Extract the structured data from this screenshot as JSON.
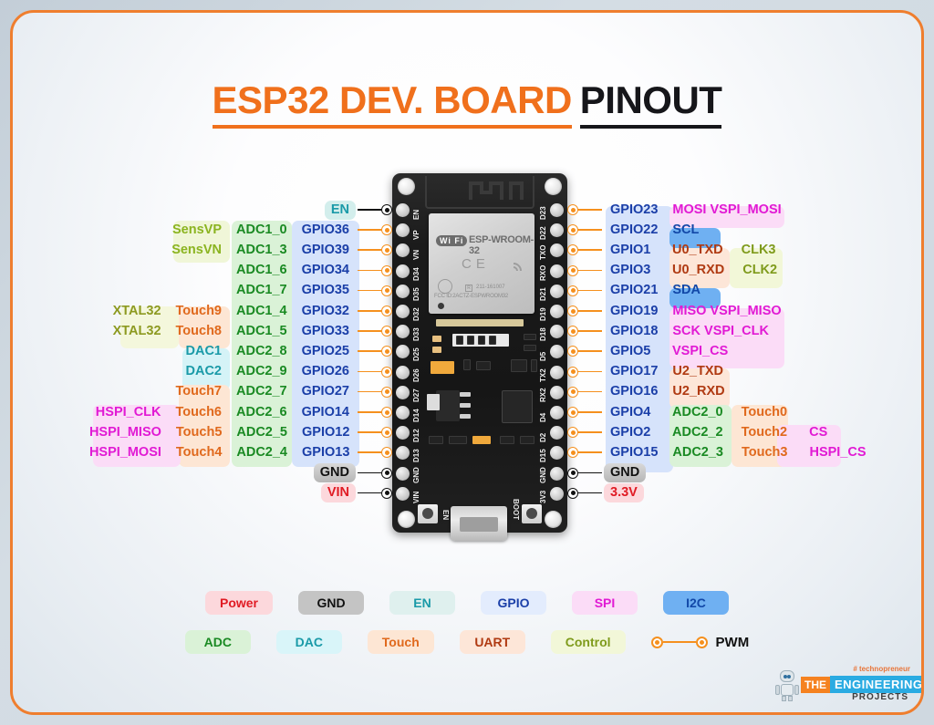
{
  "title": {
    "part1": "ESP32 DEV. BOARD",
    "part2": "PINOUT"
  },
  "board": {
    "module_name": "ESP-WROOM-32",
    "wifi_logo": "Wi Fi",
    "fcc": "FCC ID:2ACTZ-ESPWROOM32",
    "module_id": "211-161007",
    "ce_mark": "CE",
    "r_mark": "R",
    "btn_en": "EN",
    "btn_boot": "BOOT",
    "silk_left": [
      "EN",
      "VP",
      "VN",
      "D34",
      "D35",
      "D32",
      "D33",
      "D25",
      "D26",
      "D27",
      "D14",
      "D12",
      "D13",
      "GND",
      "VIN"
    ],
    "silk_right": [
      "D23",
      "D22",
      "TXO",
      "RXO",
      "D21",
      "D19",
      "D18",
      "D5",
      "TX2",
      "RX2",
      "D4",
      "D2",
      "D15",
      "GND",
      "3V3"
    ]
  },
  "left_pins": [
    {
      "gpio": "EN",
      "conn": "plain",
      "adc": "",
      "touch": "",
      "extra": "",
      "extra2": ""
    },
    {
      "gpio": "GPIO36",
      "conn": "pwm",
      "adc": "ADC1_0",
      "touch": "",
      "extra": "SensVP",
      "extra2": ""
    },
    {
      "gpio": "GPIO39",
      "conn": "pwm",
      "adc": "ADC1_3",
      "touch": "",
      "extra": "SensVN",
      "extra2": ""
    },
    {
      "gpio": "GPIO34",
      "conn": "pwm",
      "adc": "ADC1_6",
      "touch": "",
      "extra": "",
      "extra2": ""
    },
    {
      "gpio": "GPIO35",
      "conn": "pwm",
      "adc": "ADC1_7",
      "touch": "",
      "extra": "",
      "extra2": ""
    },
    {
      "gpio": "GPIO32",
      "conn": "pwm",
      "adc": "ADC1_4",
      "touch": "Touch9",
      "extra": "XTAL32",
      "extra2": ""
    },
    {
      "gpio": "GPIO33",
      "conn": "pwm",
      "adc": "ADC1_5",
      "touch": "Touch8",
      "extra": "XTAL32",
      "extra2": ""
    },
    {
      "gpio": "GPIO25",
      "conn": "pwm",
      "adc": "ADC2_8",
      "touch": "DAC1",
      "extra": "",
      "extra2": ""
    },
    {
      "gpio": "GPIO26",
      "conn": "pwm",
      "adc": "ADC2_9",
      "touch": "DAC2",
      "extra": "",
      "extra2": ""
    },
    {
      "gpio": "GPIO27",
      "conn": "pwm",
      "adc": "ADC2_7",
      "touch": "Touch7",
      "extra": "",
      "extra2": ""
    },
    {
      "gpio": "GPIO14",
      "conn": "pwm",
      "adc": "ADC2_6",
      "touch": "Touch6",
      "extra": "HSPI_CLK",
      "extra2": ""
    },
    {
      "gpio": "GPIO12",
      "conn": "pwm",
      "adc": "ADC2_5",
      "touch": "Touch5",
      "extra": "HSPI_MISO",
      "extra2": ""
    },
    {
      "gpio": "GPIO13",
      "conn": "pwm",
      "adc": "ADC2_4",
      "touch": "Touch4",
      "extra": "HSPI_MOSI",
      "extra2": ""
    },
    {
      "gpio": "GND",
      "conn": "plain",
      "adc": "",
      "touch": "",
      "extra": "",
      "extra2": ""
    },
    {
      "gpio": "VIN",
      "conn": "plain",
      "adc": "",
      "touch": "",
      "extra": "",
      "extra2": ""
    }
  ],
  "right_pins": [
    {
      "gpio": "GPIO23",
      "conn": "pwm",
      "f1": "MOSI VSPI_MOSI",
      "f2": "",
      "f3": ""
    },
    {
      "gpio": "GPIO22",
      "conn": "pwm",
      "f1": "SCL",
      "f2": "",
      "f3": ""
    },
    {
      "gpio": "GPIO1",
      "conn": "pwm",
      "f1": "U0_TXD",
      "f2": "CLK3",
      "f3": ""
    },
    {
      "gpio": "GPIO3",
      "conn": "pwm",
      "f1": "U0_RXD",
      "f2": "CLK2",
      "f3": ""
    },
    {
      "gpio": "GPIO21",
      "conn": "pwm",
      "f1": "SDA",
      "f2": "",
      "f3": ""
    },
    {
      "gpio": "GPIO19",
      "conn": "pwm",
      "f1": "MISO VSPI_MISO",
      "f2": "",
      "f3": ""
    },
    {
      "gpio": "GPIO18",
      "conn": "pwm",
      "f1": "SCK VSPI_CLK",
      "f2": "",
      "f3": ""
    },
    {
      "gpio": "GPIO5",
      "conn": "pwm",
      "f1": "VSPI_CS",
      "f2": "",
      "f3": ""
    },
    {
      "gpio": "GPIO17",
      "conn": "pwm",
      "f1": "U2_TXD",
      "f2": "",
      "f3": ""
    },
    {
      "gpio": "GPIO16",
      "conn": "pwm",
      "f1": "U2_RXD",
      "f2": "",
      "f3": ""
    },
    {
      "gpio": "GPIO4",
      "conn": "pwm",
      "f1": "ADC2_0",
      "f2": "Touch0",
      "f3": ""
    },
    {
      "gpio": "GPIO2",
      "conn": "pwm",
      "f1": "ADC2_2",
      "f2": "Touch2",
      "f3": "CS"
    },
    {
      "gpio": "GPIO15",
      "conn": "pwm",
      "f1": "ADC2_3",
      "f2": "Touch3",
      "f3": "HSPI_CS"
    },
    {
      "gpio": "GND",
      "conn": "plain",
      "f1": "",
      "f2": "",
      "f3": ""
    },
    {
      "gpio": "3.3V",
      "conn": "plain",
      "f1": "",
      "f2": "",
      "f3": ""
    }
  ],
  "legend": {
    "row1": [
      {
        "label": "Power",
        "bg": "#fcd8dc",
        "fg": "#e01b24"
      },
      {
        "label": "GND",
        "bg": "#c4c4c4",
        "fg": "#111111"
      },
      {
        "label": "EN",
        "bg": "#dff0ee",
        "fg": "#1a9aa8"
      },
      {
        "label": "GPIO",
        "bg": "#e3ecfd",
        "fg": "#1b3fa8"
      },
      {
        "label": "SPI",
        "bg": "#fbdcf7",
        "fg": "#e11ad4"
      },
      {
        "label": "I2C",
        "bg": "#6fb0f2",
        "fg": "#1248a8"
      }
    ],
    "row2": [
      {
        "label": "ADC",
        "bg": "#daf2d7",
        "fg": "#1a8a23"
      },
      {
        "label": "DAC",
        "bg": "#d9f5f9",
        "fg": "#1a9aa8"
      },
      {
        "label": "Touch",
        "bg": "#fde6d4",
        "fg": "#e0691d"
      },
      {
        "label": "UART",
        "bg": "#fde6d8",
        "fg": "#b03a12"
      },
      {
        "label": "Control",
        "bg": "#f2f7d8",
        "fg": "#7f9b1c"
      }
    ],
    "pwm_label": "PWM"
  },
  "footer": {
    "tagline": "# technopreneur",
    "the": "THE",
    "engineering": "ENGINEERING",
    "projects": "PROJECTS"
  },
  "colors": {
    "accent_orange": "#ef7e2e",
    "title_black": "#16161a",
    "pwm_orange": "#f5901e"
  }
}
